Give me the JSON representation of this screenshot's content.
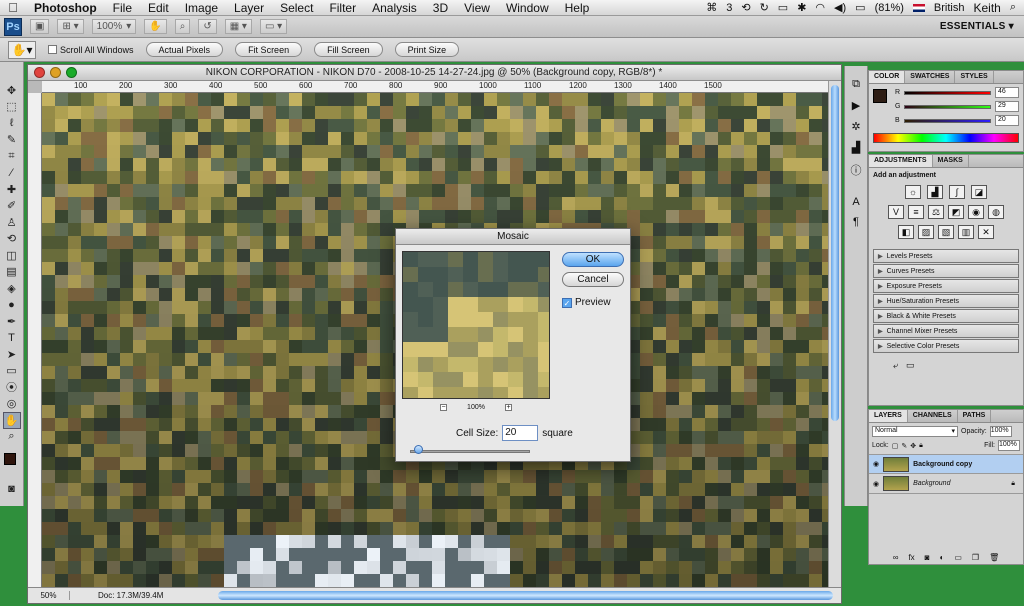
{
  "menubar": {
    "app_name": "Photoshop",
    "items": [
      "File",
      "Edit",
      "Image",
      "Layer",
      "Select",
      "Filter",
      "Analysis",
      "3D",
      "View",
      "Window",
      "Help"
    ],
    "status": {
      "notifications": "3",
      "battery": "(81%)",
      "language": "British",
      "user": "Keith"
    }
  },
  "appbar": {
    "logo": "Ps",
    "zoom": "100%",
    "workspace": "ESSENTIALS ▾"
  },
  "options": {
    "scroll_all_windows": "Scroll All Windows",
    "actual_pixels": "Actual Pixels",
    "fit_screen": "Fit Screen",
    "fill_screen": "Fill Screen",
    "print_size": "Print Size"
  },
  "document": {
    "title": "NIKON CORPORATION - NIKON D70 - 2008-10-25 14-27-24.jpg @ 50% (Background copy, RGB/8*) *",
    "ruler_labels": [
      "100",
      "200",
      "300",
      "400",
      "500",
      "600",
      "700",
      "800",
      "900",
      "1000",
      "1100",
      "1200",
      "1300",
      "1400",
      "1500"
    ],
    "zoom": "50%",
    "doc_size": "Doc: 17.3M/39.4M"
  },
  "color_panel": {
    "tabs": [
      "COLOR",
      "SWATCHES",
      "STYLES"
    ],
    "r_label": "R",
    "r_value": "46",
    "g_label": "G",
    "g_value": "29",
    "b_label": "B",
    "b_value": "20",
    "fg_color": "#2e1d14"
  },
  "adjustments_panel": {
    "tabs": [
      "ADJUSTMENTS",
      "MASKS"
    ],
    "heading": "Add an adjustment",
    "presets": [
      "Levels Presets",
      "Curves Presets",
      "Exposure Presets",
      "Hue/Saturation Presets",
      "Black & White Presets",
      "Channel Mixer Presets",
      "Selective Color Presets"
    ]
  },
  "layers_panel": {
    "tabs": [
      "LAYERS",
      "CHANNELS",
      "PATHS"
    ],
    "blend_mode": "Normal",
    "opacity_label": "Opacity:",
    "opacity_value": "100%",
    "lock_label": "Lock:",
    "fill_label": "Fill:",
    "fill_value": "100%",
    "layers": [
      {
        "name": "Background copy",
        "selected": true
      },
      {
        "name": "Background",
        "selected": false
      }
    ]
  },
  "dialog": {
    "title": "Mosaic",
    "ok": "OK",
    "cancel": "Cancel",
    "preview_label": "Preview",
    "preview_checked": true,
    "zoom": "100%",
    "cell_size_label": "Cell Size:",
    "cell_size_value": "20",
    "cell_size_unit": "square"
  }
}
